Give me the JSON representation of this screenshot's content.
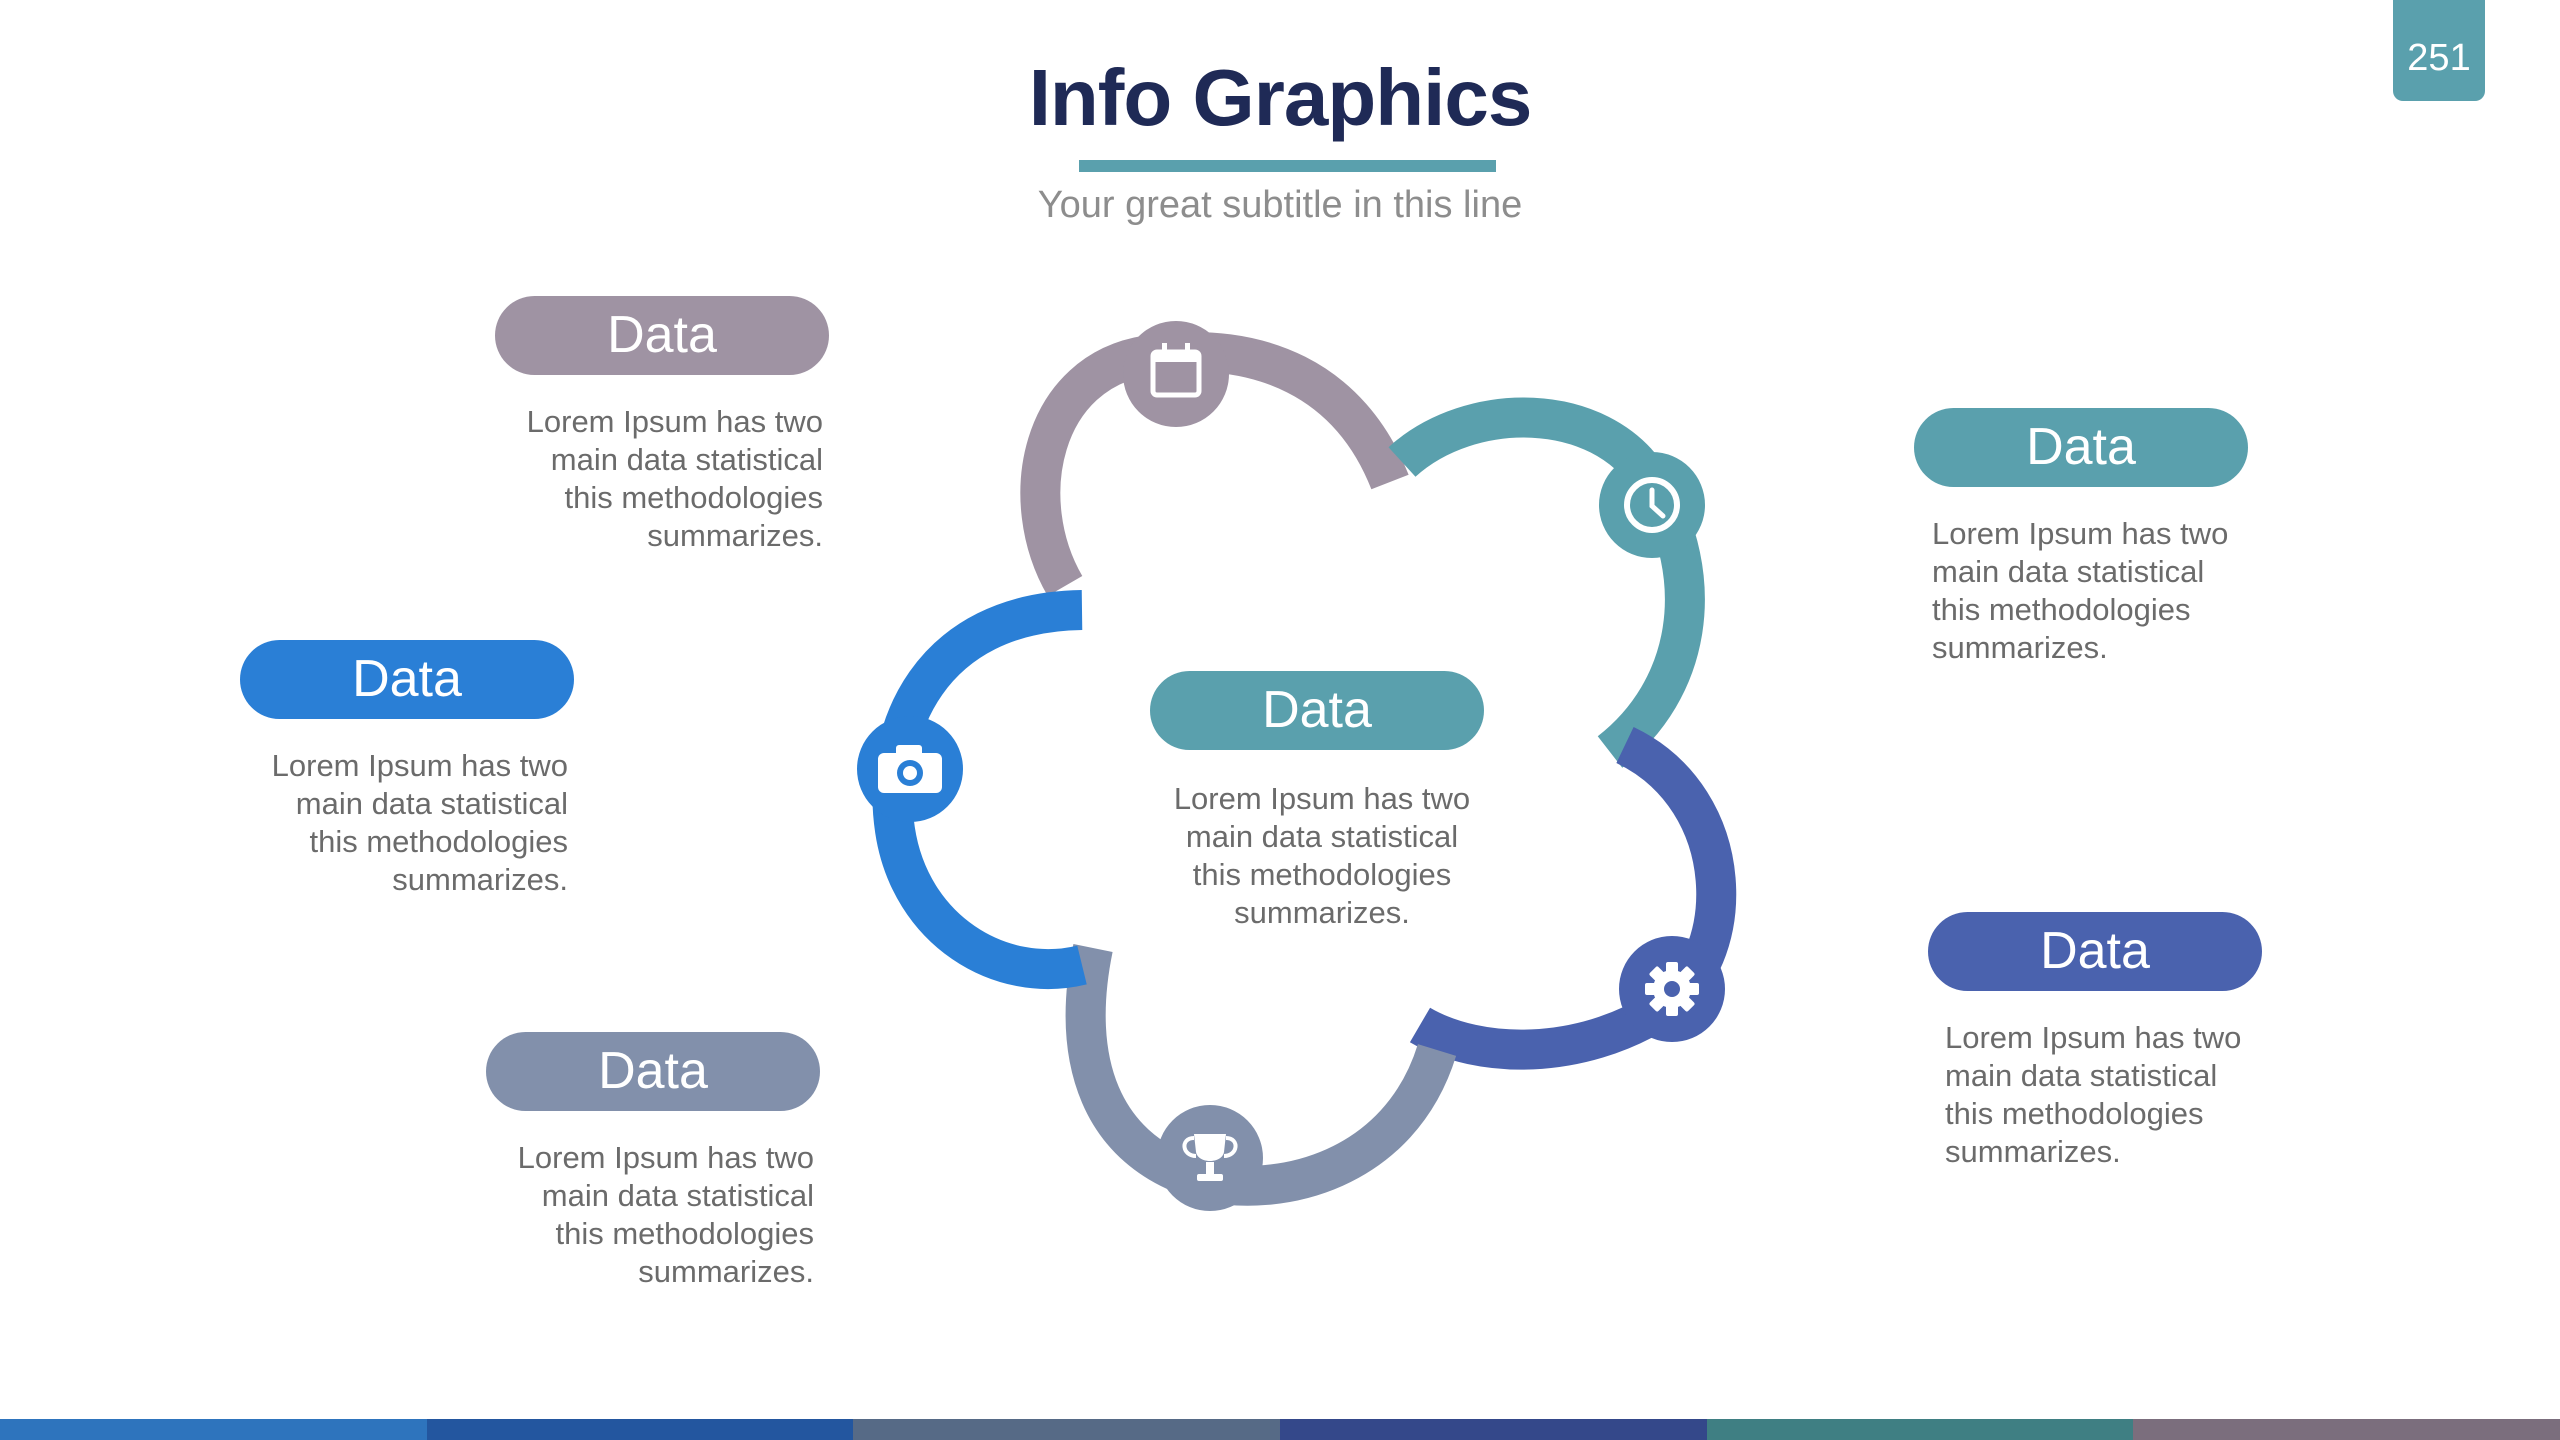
{
  "page_number": "251",
  "title": "Info Graphics",
  "subtitle": "Your great subtitle in this line",
  "colors": {
    "teal": "#5aa0ad",
    "mauve": "#9f93a3",
    "blue": "#2a7fd6",
    "slate": "#8290ab",
    "indigo": "#4a62ae",
    "navy": "#1f2a56"
  },
  "center": {
    "label": "Data",
    "text": [
      "Lorem Ipsum has two",
      "main data statistical",
      "this methodologies",
      "summarizes."
    ]
  },
  "items": [
    {
      "label": "Data",
      "color": "#9f93a3",
      "icon": "calendar-icon",
      "text": [
        "Lorem Ipsum has two",
        "main data statistical",
        "this methodologies",
        "summarizes."
      ]
    },
    {
      "label": "Data",
      "color": "#5aa0ad",
      "icon": "clock-icon",
      "text": [
        "Lorem Ipsum has two",
        "main data statistical",
        "this methodologies",
        "summarizes."
      ]
    },
    {
      "label": "Data",
      "color": "#2a7fd6",
      "icon": "camera-icon",
      "text": [
        "Lorem Ipsum has two",
        "main data statistical",
        "this methodologies",
        "summarizes."
      ]
    },
    {
      "label": "Data",
      "color": "#4a62ae",
      "icon": "gear-icon",
      "text": [
        "Lorem Ipsum has two",
        "main data statistical",
        "this methodologies",
        "summarizes."
      ]
    },
    {
      "label": "Data",
      "color": "#8290ab",
      "icon": "trophy-icon",
      "text": [
        "Lorem Ipsum has two",
        "main data statistical",
        "this methodologies",
        "summarizes."
      ]
    }
  ],
  "footer_colors": [
    "#2e74bd",
    "#23569f",
    "#566a86",
    "#34488a",
    "#3f7f83",
    "#7b6e7d"
  ]
}
